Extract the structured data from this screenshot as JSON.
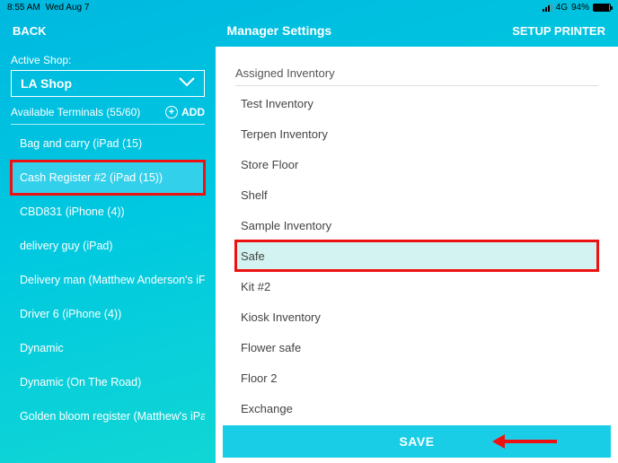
{
  "status": {
    "time": "8:55 AM",
    "date": "Wed Aug 7",
    "network": "4G",
    "battery_pct": "94%"
  },
  "header": {
    "back": "BACK",
    "title": "Manager Settings",
    "setup_printer": "SETUP PRINTER"
  },
  "sidebar": {
    "active_shop_label": "Active Shop:",
    "active_shop": "LA Shop",
    "terminals_label": "Available Terminals (55/60)",
    "add_label": "ADD",
    "terminals": [
      {
        "label": "Bag and carry (iPad (15)"
      },
      {
        "label": "Cash Register #2 (iPad (15))",
        "selected": true
      },
      {
        "label": "CBD831 (iPhone (4))"
      },
      {
        "label": "delivery guy (iPad)"
      },
      {
        "label": "Delivery man  (Matthew Anderson's iF"
      },
      {
        "label": "Driver 6 (iPhone (4))"
      },
      {
        "label": "Dynamic"
      },
      {
        "label": "Dynamic  (On The Road)"
      },
      {
        "label": "Golden bloom register (Matthew's iPa"
      }
    ]
  },
  "panel": {
    "section_title": "Assigned Inventory",
    "inventory": [
      {
        "label": "Test Inventory"
      },
      {
        "label": "Terpen Inventory"
      },
      {
        "label": "Store Floor"
      },
      {
        "label": "Shelf"
      },
      {
        "label": "Sample Inventory"
      },
      {
        "label": "Safe",
        "selected": true
      },
      {
        "label": "Kit #2"
      },
      {
        "label": "Kiosk Inventory"
      },
      {
        "label": "Flower safe"
      },
      {
        "label": "Floor 2"
      },
      {
        "label": "Exchange"
      }
    ],
    "save_label": "SAVE"
  }
}
